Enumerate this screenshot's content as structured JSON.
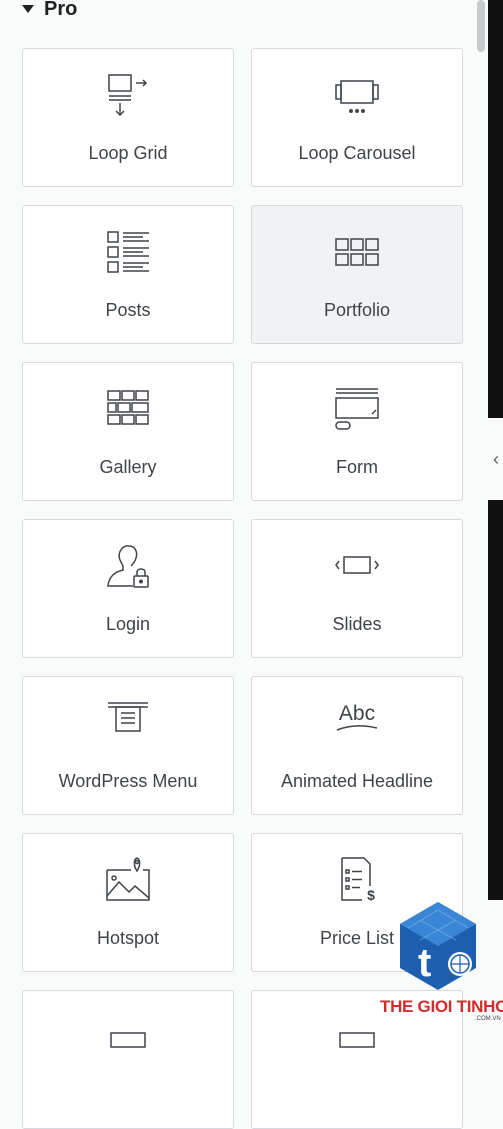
{
  "section": {
    "title": "Pro",
    "toggle_icon": "caret-down-icon"
  },
  "widgets": [
    {
      "label": "Loop Grid",
      "icon": "loop-grid-icon"
    },
    {
      "label": "Loop Carousel",
      "icon": "loop-carousel-icon"
    },
    {
      "label": "Posts",
      "icon": "posts-icon"
    },
    {
      "label": "Portfolio",
      "icon": "portfolio-icon"
    },
    {
      "label": "Gallery",
      "icon": "gallery-icon"
    },
    {
      "label": "Form",
      "icon": "form-icon"
    },
    {
      "label": "Login",
      "icon": "login-icon"
    },
    {
      "label": "Slides",
      "icon": "slides-icon"
    },
    {
      "label": "WordPress Menu",
      "icon": "wordpress-menu-icon"
    },
    {
      "label": "Animated Headline",
      "icon": "animated-headline-icon"
    },
    {
      "label": "Hotspot",
      "icon": "hotspot-icon"
    },
    {
      "label": "Price List",
      "icon": "price-list-icon"
    },
    {
      "label": "",
      "icon": "partial-widget-icon"
    },
    {
      "label": "",
      "icon": "partial-widget-icon"
    }
  ],
  "collapse_icon": "chevron-left-icon",
  "watermark": {
    "text": "THE GIOI TINHOC",
    "subtext": ".COM.VN",
    "logo_letter": "t"
  },
  "colors": {
    "card_border": "#d5d8dc",
    "text": "#3f444b",
    "hover_bg": "#f1f2f3",
    "watermark_red": "#d42b2b",
    "logo_blue": "#1d5fae"
  }
}
